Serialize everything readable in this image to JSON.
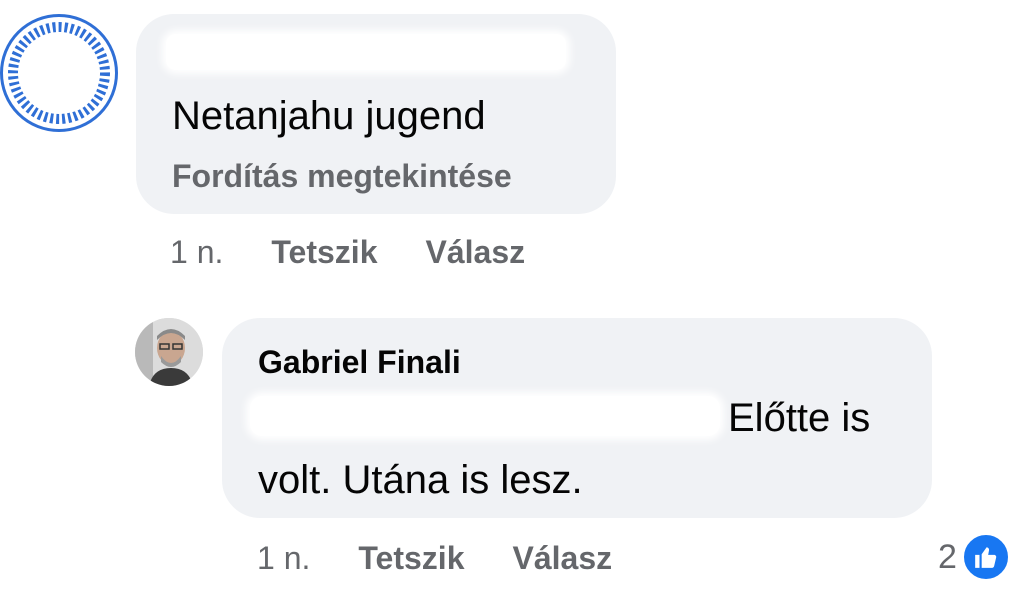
{
  "comments": [
    {
      "author": "",
      "text": "Netanjahu jugend",
      "translate_label": "Fordítás megtekintése",
      "time": "1 n.",
      "like_label": "Tetszik",
      "reply_label": "Válasz"
    },
    {
      "author": "Gabriel Finali",
      "text_line1": "Előtte is",
      "text_line2": "volt. Utána is lesz.",
      "time": "1 n.",
      "like_label": "Tetszik",
      "reply_label": "Válasz",
      "reaction_count": "2"
    }
  ],
  "icons": {
    "reaction": "thumbs-up-icon"
  },
  "colors": {
    "bubble": "#f0f2f5",
    "secondary_text": "#65676b",
    "like_blue": "#1877f2",
    "avatar_ring": "#2f6fd6"
  }
}
